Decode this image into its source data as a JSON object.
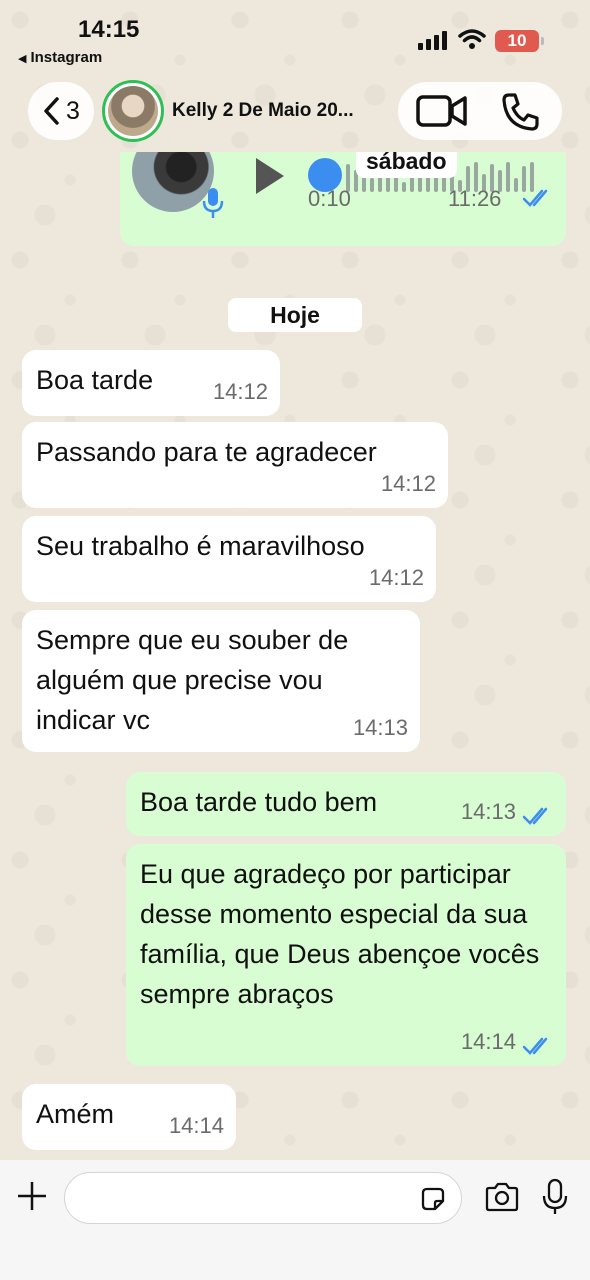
{
  "status_bar": {
    "time": "14:15",
    "back_app": "Instagram",
    "battery": "10"
  },
  "header": {
    "back_count": "3",
    "contact_name": "Kelly 2 De Maio 20..."
  },
  "voice_message": {
    "day_label": "sábado",
    "duration": "0:10",
    "time": "11:26"
  },
  "day_divider": "Hoje",
  "messages": [
    {
      "direction": "in",
      "text": "Boa tarde",
      "time": "14:12"
    },
    {
      "direction": "in",
      "text": "Passando para te agradecer",
      "time": "14:12"
    },
    {
      "direction": "in",
      "text": "Seu trabalho é maravilhoso",
      "time": "14:12"
    },
    {
      "direction": "in",
      "text": "Sempre que eu souber de alguém que precise vou indicar vc",
      "time": "14:13"
    },
    {
      "direction": "out",
      "text": "Boa tarde tudo bem",
      "time": "14:13"
    },
    {
      "direction": "out",
      "text": "Eu que agradeço por participar desse momento especial da sua família, que Deus abençoe vocês sempre abraços",
      "time": "14:14"
    },
    {
      "direction": "in",
      "text": "Amém",
      "time": "14:14"
    }
  ],
  "colors": {
    "outgoing_bubble": "#d9fdd3",
    "incoming_bubble": "#ffffff",
    "read_ticks": "#3b8ef0",
    "avatar_ring": "#2fbf55",
    "battery_low": "#e05a4f"
  }
}
